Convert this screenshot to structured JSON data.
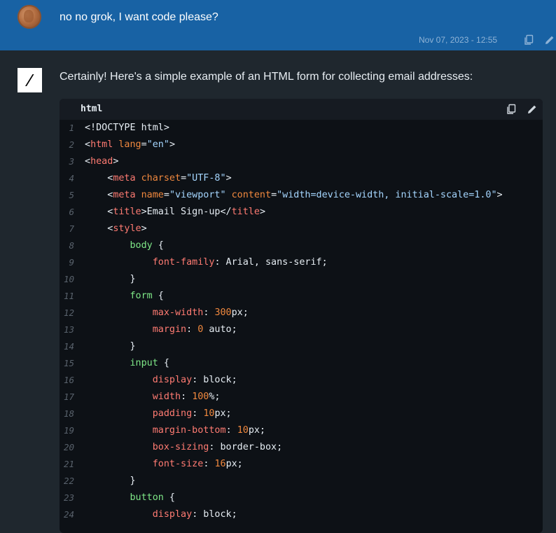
{
  "user_message": {
    "text": "no no grok, I want code please?",
    "timestamp": "Nov 07, 2023 - 12:55"
  },
  "assistant_message": {
    "text": "Certainly! Here's a simple example of an HTML form for collecting email addresses:",
    "code_block": {
      "language": "html",
      "lines": [
        {
          "n": "1",
          "tokens": [
            [
              "plain",
              "<!DOCTYPE html>"
            ]
          ]
        },
        {
          "n": "2",
          "tokens": [
            [
              "plain",
              "<"
            ],
            [
              "tag",
              "html"
            ],
            [
              "plain",
              " "
            ],
            [
              "attr",
              "lang"
            ],
            [
              "plain",
              "="
            ],
            [
              "str",
              "\"en\""
            ],
            [
              "plain",
              ">"
            ]
          ]
        },
        {
          "n": "3",
          "tokens": [
            [
              "plain",
              "<"
            ],
            [
              "tag",
              "head"
            ],
            [
              "plain",
              ">"
            ]
          ]
        },
        {
          "n": "4",
          "tokens": [
            [
              "plain",
              "    <"
            ],
            [
              "tag",
              "meta"
            ],
            [
              "plain",
              " "
            ],
            [
              "attr",
              "charset"
            ],
            [
              "plain",
              "="
            ],
            [
              "str",
              "\"UTF-8\""
            ],
            [
              "plain",
              ">"
            ]
          ]
        },
        {
          "n": "5",
          "tokens": [
            [
              "plain",
              "    <"
            ],
            [
              "tag",
              "meta"
            ],
            [
              "plain",
              " "
            ],
            [
              "attr",
              "name"
            ],
            [
              "plain",
              "="
            ],
            [
              "str",
              "\"viewport\""
            ],
            [
              "plain",
              " "
            ],
            [
              "attr",
              "content"
            ],
            [
              "plain",
              "="
            ],
            [
              "str",
              "\"width=device-width, initial-scale=1.0\""
            ],
            [
              "plain",
              ">"
            ]
          ]
        },
        {
          "n": "6",
          "tokens": [
            [
              "plain",
              "    <"
            ],
            [
              "tag",
              "title"
            ],
            [
              "plain",
              ">Email Sign-up</"
            ],
            [
              "tag",
              "title"
            ],
            [
              "plain",
              ">"
            ]
          ]
        },
        {
          "n": "7",
          "tokens": [
            [
              "plain",
              "    <"
            ],
            [
              "tag",
              "style"
            ],
            [
              "plain",
              ">"
            ]
          ]
        },
        {
          "n": "8",
          "tokens": [
            [
              "plain",
              "        "
            ],
            [
              "sel",
              "body"
            ],
            [
              "plain",
              " {"
            ]
          ]
        },
        {
          "n": "9",
          "tokens": [
            [
              "plain",
              "            "
            ],
            [
              "prop",
              "font-family"
            ],
            [
              "plain",
              ": Arial, sans-serif;"
            ]
          ]
        },
        {
          "n": "10",
          "tokens": [
            [
              "plain",
              "        }"
            ]
          ]
        },
        {
          "n": "11",
          "tokens": [
            [
              "plain",
              "        "
            ],
            [
              "sel",
              "form"
            ],
            [
              "plain",
              " {"
            ]
          ]
        },
        {
          "n": "12",
          "tokens": [
            [
              "plain",
              "            "
            ],
            [
              "prop",
              "max-width"
            ],
            [
              "plain",
              ": "
            ],
            [
              "num",
              "300"
            ],
            [
              "plain",
              "px;"
            ]
          ]
        },
        {
          "n": "13",
          "tokens": [
            [
              "plain",
              "            "
            ],
            [
              "prop",
              "margin"
            ],
            [
              "plain",
              ": "
            ],
            [
              "num",
              "0"
            ],
            [
              "plain",
              " auto;"
            ]
          ]
        },
        {
          "n": "14",
          "tokens": [
            [
              "plain",
              "        }"
            ]
          ]
        },
        {
          "n": "15",
          "tokens": [
            [
              "plain",
              "        "
            ],
            [
              "sel",
              "input"
            ],
            [
              "plain",
              " {"
            ]
          ]
        },
        {
          "n": "16",
          "tokens": [
            [
              "plain",
              "            "
            ],
            [
              "prop",
              "display"
            ],
            [
              "plain",
              ": block;"
            ]
          ]
        },
        {
          "n": "17",
          "tokens": [
            [
              "plain",
              "            "
            ],
            [
              "prop",
              "width"
            ],
            [
              "plain",
              ": "
            ],
            [
              "num",
              "100"
            ],
            [
              "plain",
              "%;"
            ]
          ]
        },
        {
          "n": "18",
          "tokens": [
            [
              "plain",
              "            "
            ],
            [
              "prop",
              "padding"
            ],
            [
              "plain",
              ": "
            ],
            [
              "num",
              "10"
            ],
            [
              "plain",
              "px;"
            ]
          ]
        },
        {
          "n": "19",
          "tokens": [
            [
              "plain",
              "            "
            ],
            [
              "prop",
              "margin-bottom"
            ],
            [
              "plain",
              ": "
            ],
            [
              "num",
              "10"
            ],
            [
              "plain",
              "px;"
            ]
          ]
        },
        {
          "n": "20",
          "tokens": [
            [
              "plain",
              "            "
            ],
            [
              "prop",
              "box-sizing"
            ],
            [
              "plain",
              ": border-box;"
            ]
          ]
        },
        {
          "n": "21",
          "tokens": [
            [
              "plain",
              "            "
            ],
            [
              "prop",
              "font-size"
            ],
            [
              "plain",
              ": "
            ],
            [
              "num",
              "16"
            ],
            [
              "plain",
              "px;"
            ]
          ]
        },
        {
          "n": "22",
          "tokens": [
            [
              "plain",
              "        }"
            ]
          ]
        },
        {
          "n": "23",
          "tokens": [
            [
              "plain",
              "        "
            ],
            [
              "sel",
              "button"
            ],
            [
              "plain",
              " {"
            ]
          ]
        },
        {
          "n": "24",
          "tokens": [
            [
              "plain",
              "            "
            ],
            [
              "prop",
              "display"
            ],
            [
              "plain",
              ": block;"
            ]
          ]
        }
      ]
    }
  },
  "icons": {
    "copy": "copy-icon",
    "edit": "pencil-icon",
    "logo": "grok-logo"
  },
  "colors": {
    "user_bg": "#1862a4",
    "page_bg": "#1f272e",
    "code_bg": "#0d1116"
  }
}
